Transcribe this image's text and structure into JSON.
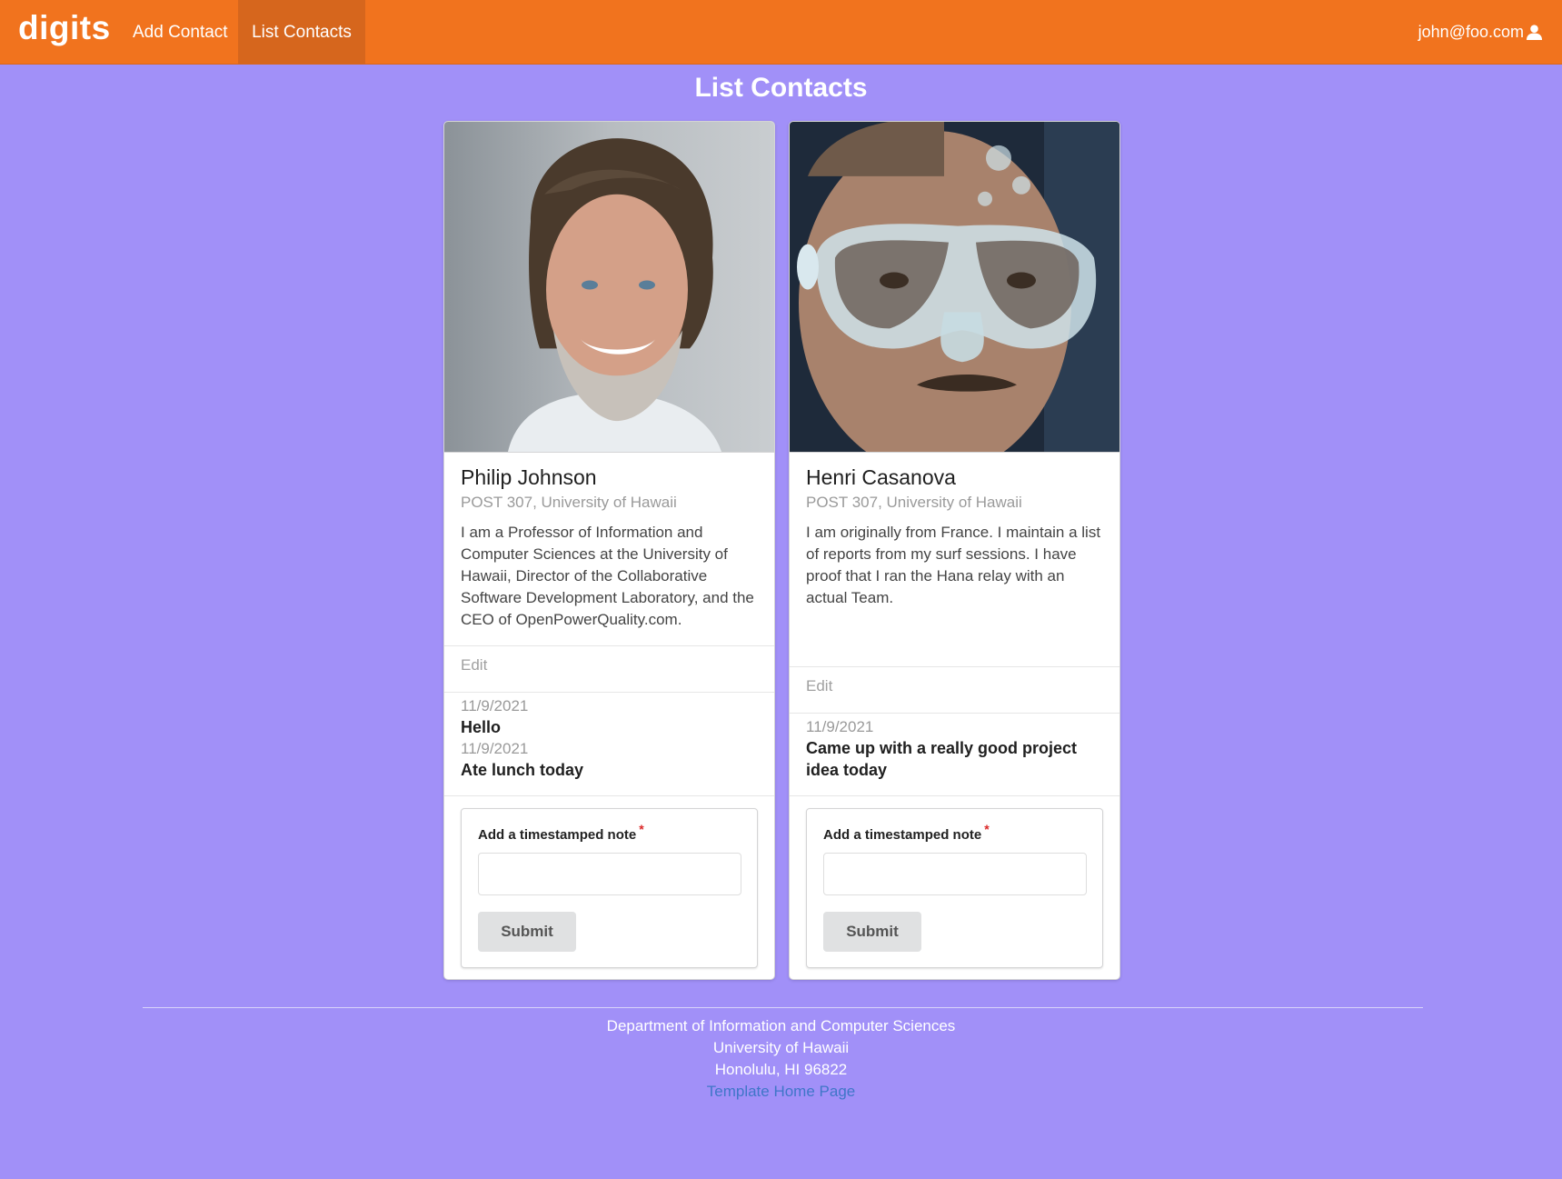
{
  "navbar": {
    "brand": "digits",
    "items": [
      {
        "label": "Add Contact"
      },
      {
        "label": "List Contacts",
        "active": true
      }
    ],
    "user": "john@foo.com",
    "user_icon": "user-icon",
    "colors": {
      "background": "#f1731e",
      "active": "#d6661d"
    }
  },
  "page": {
    "title": "List Contacts",
    "background": "#a190f8"
  },
  "contacts": [
    {
      "name": "Philip Johnson",
      "address": "POST 307, University of Hawaii",
      "description": "I am a Professor of Information and Computer Sciences at the University of Hawaii, Director of the Collaborative Software Development Laboratory, and the CEO of OpenPowerQuality.com.",
      "edit_label": "Edit",
      "notes": [
        {
          "date": "11/9/2021",
          "text": "Hello"
        },
        {
          "date": "11/9/2021",
          "text": "Ate lunch today"
        }
      ],
      "form": {
        "label": "Add a timestamped note",
        "required": "*",
        "input_value": "",
        "submit_label": "Submit"
      }
    },
    {
      "name": "Henri Casanova",
      "address": "POST 307, University of Hawaii",
      "description": "I am originally from France. I maintain a list of reports from my surf sessions. I have proof that I ran the Hana relay with an actual Team.",
      "edit_label": "Edit",
      "notes": [
        {
          "date": "11/9/2021",
          "text": "Came up with a really good project idea today"
        }
      ],
      "form": {
        "label": "Add a timestamped note",
        "required": "*",
        "input_value": "",
        "submit_label": "Submit"
      }
    }
  ],
  "footer": {
    "line1": "Department of Information and Computer Sciences",
    "line2": "University of Hawaii",
    "line3": "Honolulu, HI 96822",
    "link": "Template Home Page"
  }
}
